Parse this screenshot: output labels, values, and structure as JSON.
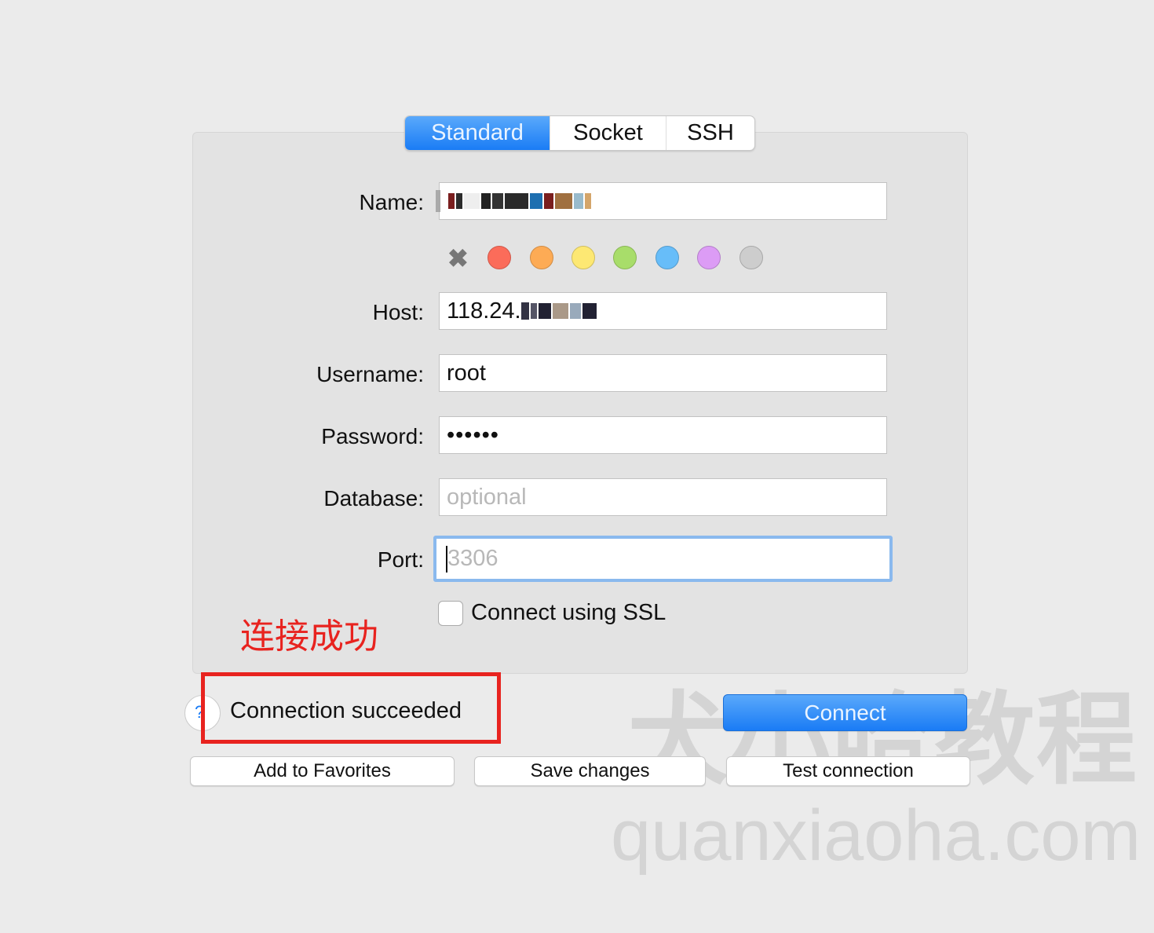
{
  "tabs": [
    {
      "label": "Standard",
      "active": true
    },
    {
      "label": "Socket"
    },
    {
      "label": "SSH"
    }
  ],
  "form": {
    "name_label": "Name:",
    "name_value": "(pixelated)",
    "host_label": "Host:",
    "host_value": "118.24.",
    "username_label": "Username:",
    "username_value": "root",
    "password_label": "Password:",
    "password_value": "••••••",
    "database_label": "Database:",
    "database_placeholder": "optional",
    "port_label": "Port:",
    "port_placeholder": "3306",
    "ssl_label": "Connect using SSL",
    "ssl_checked": false
  },
  "colors": [
    "#fb6c5a",
    "#fdab55",
    "#fde873",
    "#a8dd6a",
    "#67bdf9",
    "#dc9cf5",
    "#cdcdcd"
  ],
  "annotation": "连接成功",
  "status": "Connection succeeded",
  "buttons": {
    "connect": "Connect",
    "add_favorites": "Add to Favorites",
    "save": "Save changes",
    "test": "Test connection"
  },
  "watermark": {
    "cn": "犬小哈教程",
    "url": "quanxiaoha.com"
  }
}
